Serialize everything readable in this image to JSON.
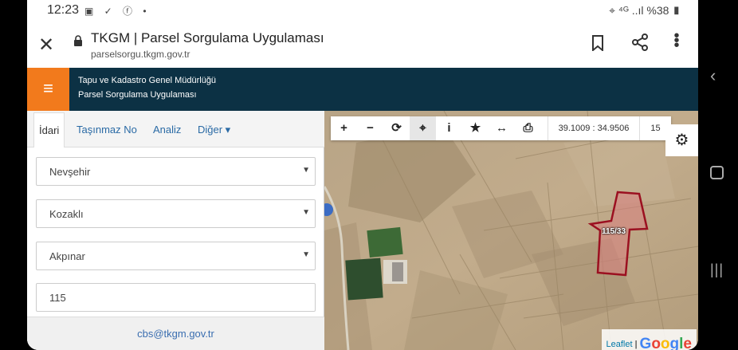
{
  "status_bar": {
    "time": "12:23",
    "left_icons": "▣ ✓ ⓕ •",
    "right_icons": "⌖ ⁴ᴳ ..ıl",
    "battery": "%38"
  },
  "browser": {
    "title": "TKGM | Parsel Sorgulama Uygulaması",
    "url": "parselsorgu.tkgm.gov.tr",
    "close_icon": "close-icon",
    "more_icon": "more-vertical-icon"
  },
  "header": {
    "menu_icon": "≡",
    "line1": "Tapu ve Kadastro Genel Müdürlüğü",
    "line2": "Parsel Sorgulama Uygulaması"
  },
  "tabs": [
    {
      "label": "İdari",
      "active": true
    },
    {
      "label": "Taşınmaz No",
      "active": false
    },
    {
      "label": "Analiz",
      "active": false
    },
    {
      "label": "Diğer ▾",
      "active": false
    }
  ],
  "form": {
    "il": "Nevşehir",
    "ilce": "Kozaklı",
    "mahalle": "Akpınar",
    "ada": "115",
    "arrow": "▼"
  },
  "footer": {
    "email": "cbs@tkgm.gov.tr"
  },
  "map": {
    "toolbar": {
      "zoom_in": "+",
      "zoom_out": "−",
      "refresh": "⟳",
      "locate": "⌖",
      "info": "i",
      "favorite": "★",
      "measure": "↔",
      "print": "⎙"
    },
    "coordinates": "39.1009 : 34.9506",
    "zoom_level": "15",
    "settings_icon": "⚙",
    "parcel_label": "115/33",
    "attribution_leaflet": "Leaflet",
    "attribution_sep": " | ",
    "attribution_google": "Google",
    "colors": {
      "parcel_stroke": "#9b1020",
      "parcel_fill": "#d88080"
    }
  },
  "nav": {
    "back": "‹",
    "recents": "|||"
  }
}
